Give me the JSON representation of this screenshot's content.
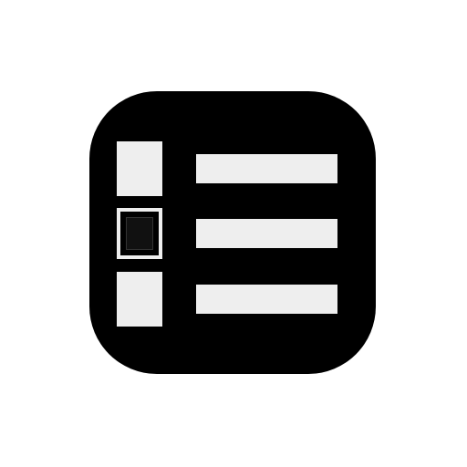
{
  "icon": {
    "semantic": "list-view-icon",
    "rows": [
      {
        "indicator": "plain",
        "selected": false
      },
      {
        "indicator": "checkbox",
        "selected": true
      },
      {
        "indicator": "plain",
        "selected": false
      }
    ]
  },
  "colors": {
    "background": "#ffffff",
    "tile": "#000000",
    "light": "#eeeeee",
    "dark": "#111111"
  }
}
